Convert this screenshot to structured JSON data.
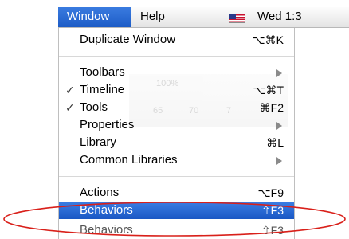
{
  "menubar": {
    "window_label": "Window",
    "help_label": "Help",
    "flag_icon": "us-flag-icon",
    "clock_text": "Wed 1:3"
  },
  "menu": {
    "items": [
      {
        "label": "Duplicate Window",
        "shortcut": "⌥⌘K",
        "checked": false,
        "submenu": false
      },
      {
        "label": "Toolbars",
        "shortcut": "",
        "checked": false,
        "submenu": true
      },
      {
        "label": "Timeline",
        "shortcut": "⌥⌘T",
        "checked": true,
        "submenu": false
      },
      {
        "label": "Tools",
        "shortcut": "⌘F2",
        "checked": true,
        "submenu": false
      },
      {
        "label": "Properties",
        "shortcut": "",
        "checked": false,
        "submenu": true
      },
      {
        "label": "Library",
        "shortcut": "⌘L",
        "checked": false,
        "submenu": false
      },
      {
        "label": "Common Libraries",
        "shortcut": "",
        "checked": false,
        "submenu": true
      },
      {
        "label": "Actions",
        "shortcut": "⌥F9",
        "checked": false,
        "submenu": false
      },
      {
        "label": "Behaviors",
        "shortcut": "⇧F3",
        "checked": false,
        "submenu": false,
        "selected": true
      },
      {
        "label": "Behaviors",
        "shortcut": "⇧F3",
        "checked": false,
        "submenu": false
      }
    ],
    "check_mark": "✓",
    "ghost": {
      "zoom": "100%",
      "ruler_a": "65",
      "ruler_b": "70",
      "ruler_c": "7"
    }
  },
  "colors": {
    "highlight": "#1d5cc6",
    "annotation": "#d9201a"
  }
}
